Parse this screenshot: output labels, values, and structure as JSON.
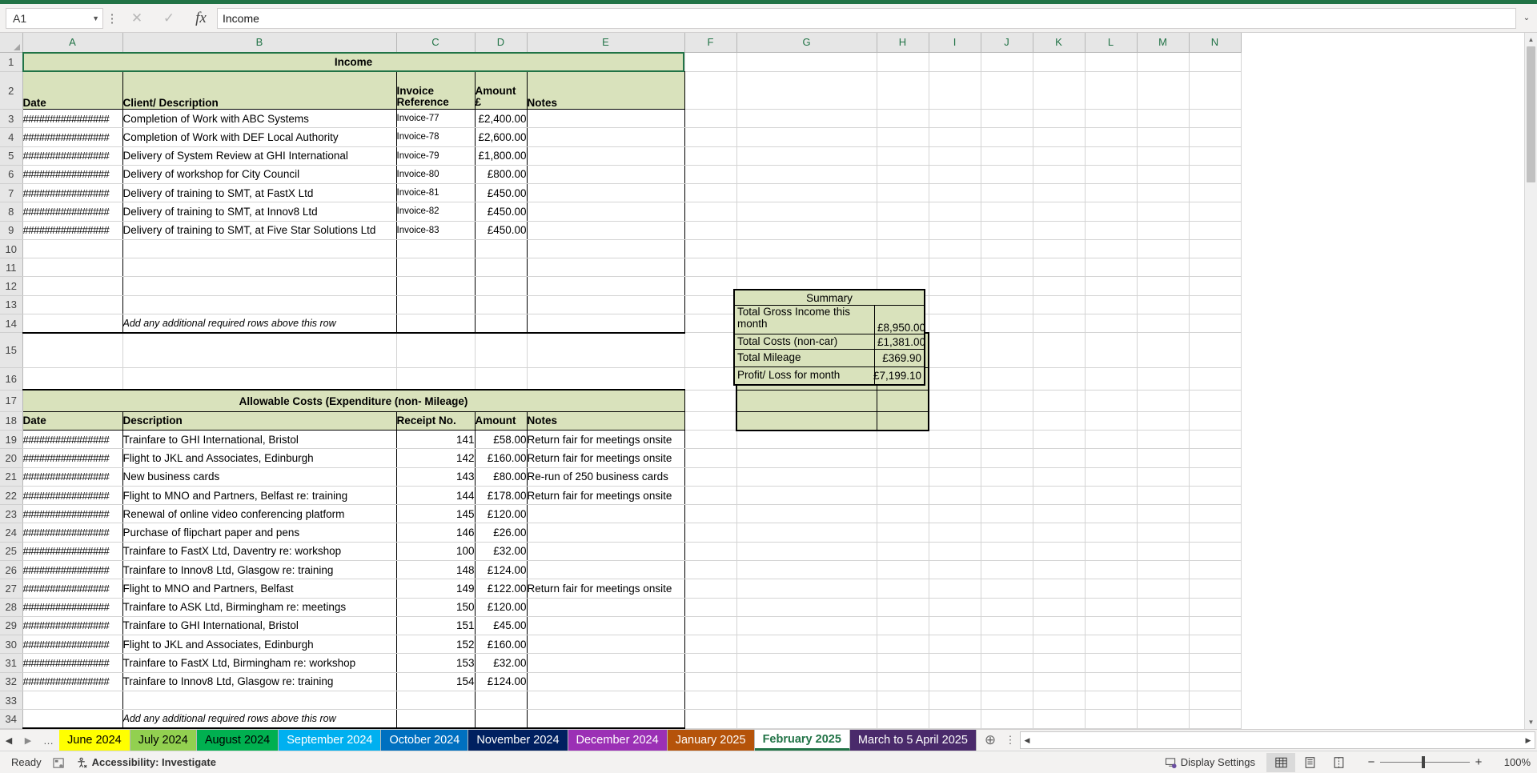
{
  "namebox": {
    "value": "A1",
    "dropdown_icon": "chevron-down-icon",
    "more_icon": "vertical-dots-icon"
  },
  "formula_bar": {
    "cancel_icon": "cancel-x-icon",
    "enter_icon": "check-icon",
    "function_icon": "fx-icon",
    "value": "Income",
    "expand_icon": "chevron-down-icon"
  },
  "columns": [
    "A",
    "B",
    "C",
    "D",
    "E",
    "F",
    "G",
    "H",
    "I",
    "J",
    "K",
    "L",
    "M",
    "N"
  ],
  "income": {
    "title": "Income",
    "headers": [
      "Date",
      "Client/ Description",
      "Invoice Reference",
      "Amount £",
      "Notes"
    ],
    "header_invoice_line1": "Invoice",
    "header_invoice_line2": "Reference",
    "header_amount_line1": "Amount",
    "header_amount_line2": "£",
    "rows": [
      {
        "row": "3",
        "date": "################",
        "desc": "Completion of Work with ABC Systems",
        "ref": "Invoice-77",
        "amount": "£2,400.00",
        "notes": ""
      },
      {
        "row": "4",
        "date": "################",
        "desc": "Completion of Work with DEF Local Authority",
        "ref": "Invoice-78",
        "amount": "£2,600.00",
        "notes": ""
      },
      {
        "row": "5",
        "date": "################",
        "desc": "Delivery of System Review at GHI International",
        "ref": "Invoice-79",
        "amount": "£1,800.00",
        "notes": ""
      },
      {
        "row": "6",
        "date": "################",
        "desc": "Delivery of workshop for City Council",
        "ref": "Invoice-80",
        "amount": "£800.00",
        "notes": ""
      },
      {
        "row": "7",
        "date": "################",
        "desc": "Delivery of training to SMT, at FastX Ltd",
        "ref": "Invoice-81",
        "amount": "£450.00",
        "notes": ""
      },
      {
        "row": "8",
        "date": "################",
        "desc": "Delivery of training to SMT, at Innov8 Ltd",
        "ref": "Invoice-82",
        "amount": "£450.00",
        "notes": ""
      },
      {
        "row": "9",
        "date": "################",
        "desc": "Delivery of training to SMT, at Five Star Solutions Ltd",
        "ref": "Invoice-83",
        "amount": "£450.00",
        "notes": ""
      },
      {
        "row": "10",
        "date": "",
        "desc": "",
        "ref": "",
        "amount": "",
        "notes": ""
      },
      {
        "row": "11",
        "date": "",
        "desc": "",
        "ref": "",
        "amount": "",
        "notes": ""
      },
      {
        "row": "12",
        "date": "",
        "desc": "",
        "ref": "",
        "amount": "",
        "notes": ""
      },
      {
        "row": "13",
        "date": "",
        "desc": "",
        "ref": "",
        "amount": "",
        "notes": ""
      }
    ],
    "footer_note": "Add any additional required rows above this row",
    "footer_row": "14"
  },
  "spacer_rows": [
    "15",
    "16"
  ],
  "expenditure": {
    "title": "Allowable Costs (Expenditure (non- Mileage)",
    "title_row": "17",
    "header_row": "18",
    "headers": [
      "Date",
      "Description",
      "Receipt No.",
      "Amount",
      "Notes"
    ],
    "rows": [
      {
        "row": "19",
        "date": "################",
        "desc": "Trainfare to GHI International, Bristol",
        "receipt": "141",
        "amount": "£58.00",
        "notes": "Return fair for meetings onsite"
      },
      {
        "row": "20",
        "date": "################",
        "desc": "Flight to JKL and Associates, Edinburgh",
        "receipt": "142",
        "amount": "£160.00",
        "notes": "Return fair for meetings onsite"
      },
      {
        "row": "21",
        "date": "################",
        "desc": "New business cards",
        "receipt": "143",
        "amount": "£80.00",
        "notes": "Re-run of 250 business cards"
      },
      {
        "row": "22",
        "date": "################",
        "desc": "Flight to MNO and Partners, Belfast re: training",
        "receipt": "144",
        "amount": "£178.00",
        "notes": "Return fair for meetings onsite"
      },
      {
        "row": "23",
        "date": "################",
        "desc": "Renewal of online video conferencing platform",
        "receipt": "145",
        "amount": "£120.00",
        "notes": ""
      },
      {
        "row": "24",
        "date": "################",
        "desc": "Purchase of flipchart paper and pens",
        "receipt": "146",
        "amount": "£26.00",
        "notes": ""
      },
      {
        "row": "25",
        "date": "################",
        "desc": "Trainfare to FastX Ltd, Daventry re: workshop",
        "receipt": "100",
        "amount": "£32.00",
        "notes": ""
      },
      {
        "row": "26",
        "date": "################",
        "desc": "Trainfare to Innov8 Ltd, Glasgow re: training",
        "receipt": "148",
        "amount": "£124.00",
        "notes": ""
      },
      {
        "row": "27",
        "date": "################",
        "desc": "Flight to MNO and Partners, Belfast",
        "receipt": "149",
        "amount": "£122.00",
        "notes": "Return fair for meetings onsite"
      },
      {
        "row": "28",
        "date": "################",
        "desc": "Trainfare to ASK Ltd, Birmingham re: meetings",
        "receipt": "150",
        "amount": "£120.00",
        "notes": ""
      },
      {
        "row": "29",
        "date": "################",
        "desc": "Trainfare to GHI International, Bristol",
        "receipt": "151",
        "amount": "£45.00",
        "notes": ""
      },
      {
        "row": "30",
        "date": "################",
        "desc": "Flight to JKL and Associates, Edinburgh",
        "receipt": "152",
        "amount": "£160.00",
        "notes": ""
      },
      {
        "row": "31",
        "date": "################",
        "desc": "Trainfare to FastX Ltd, Birmingham re: workshop",
        "receipt": "153",
        "amount": "£32.00",
        "notes": ""
      },
      {
        "row": "32",
        "date": "################",
        "desc": "Trainfare to Innov8 Ltd, Glasgow re: training",
        "receipt": "154",
        "amount": "£124.00",
        "notes": ""
      },
      {
        "row": "33",
        "date": "",
        "desc": "",
        "receipt": "",
        "amount": "",
        "notes": ""
      }
    ],
    "footer_note": "Add any additional required rows above this row",
    "footer_row": "34"
  },
  "summary": {
    "title": "Summary",
    "rows": [
      {
        "label": "Total Gross Income this month",
        "value": "£8,950.00"
      },
      {
        "label": "Total Costs (non-car)",
        "value": "£1,381.00"
      },
      {
        "label": "Total Mileage",
        "value": "£369.90"
      },
      {
        "label": "Profit/ Loss for month",
        "value": "£7,199.10"
      }
    ]
  },
  "tabs": {
    "prev_icon": "triangle-left-icon",
    "next_icon": "triangle-right-icon",
    "overflow_icon": "ellipsis-icon",
    "add_icon": "plus-circle-icon",
    "menu_icon": "vertical-dots-icon",
    "items": [
      {
        "label": "June 2024",
        "bg": "#FFFF00",
        "fg": "#000000",
        "active": false
      },
      {
        "label": "July 2024",
        "bg": "#92D050",
        "fg": "#000000",
        "active": false
      },
      {
        "label": "August 2024",
        "bg": "#00B050",
        "fg": "#000000",
        "active": false
      },
      {
        "label": "September 2024",
        "bg": "#00B0F0",
        "fg": "#FFFFFF",
        "active": false
      },
      {
        "label": "October 2024",
        "bg": "#0070C0",
        "fg": "#FFFFFF",
        "active": false
      },
      {
        "label": "November 2024",
        "bg": "#002060",
        "fg": "#FFFFFF",
        "active": false
      },
      {
        "label": "December 2024",
        "bg": "#9B30B5",
        "fg": "#FFFFFF",
        "active": false
      },
      {
        "label": "January 2025",
        "bg": "#B5530A",
        "fg": "#FFFFFF",
        "active": false
      },
      {
        "label": "February 2025",
        "bg": "#FFFFFF",
        "fg": "#217346",
        "active": true
      },
      {
        "label": "March to 5 April 2025",
        "bg": "#4A2A6B",
        "fg": "#FFFFFF",
        "active": false
      }
    ]
  },
  "statusbar": {
    "ready": "Ready",
    "macro_icon": "record-macro-icon",
    "accessibility_icon": "accessibility-icon",
    "accessibility": "Accessibility: Investigate",
    "display_settings_icon": "display-settings-icon",
    "display_settings": "Display Settings",
    "view_normal_icon": "normal-view-icon",
    "view_pagelayout_icon": "page-layout-view-icon",
    "view_pagebreak_icon": "page-break-view-icon",
    "zoom_out_icon": "minus-icon",
    "zoom_in_icon": "plus-icon",
    "zoom": "100%"
  },
  "colors": {
    "accent": "#217346",
    "header_fill": "#d9e2bc",
    "grid_line": "#d4d4d4"
  }
}
